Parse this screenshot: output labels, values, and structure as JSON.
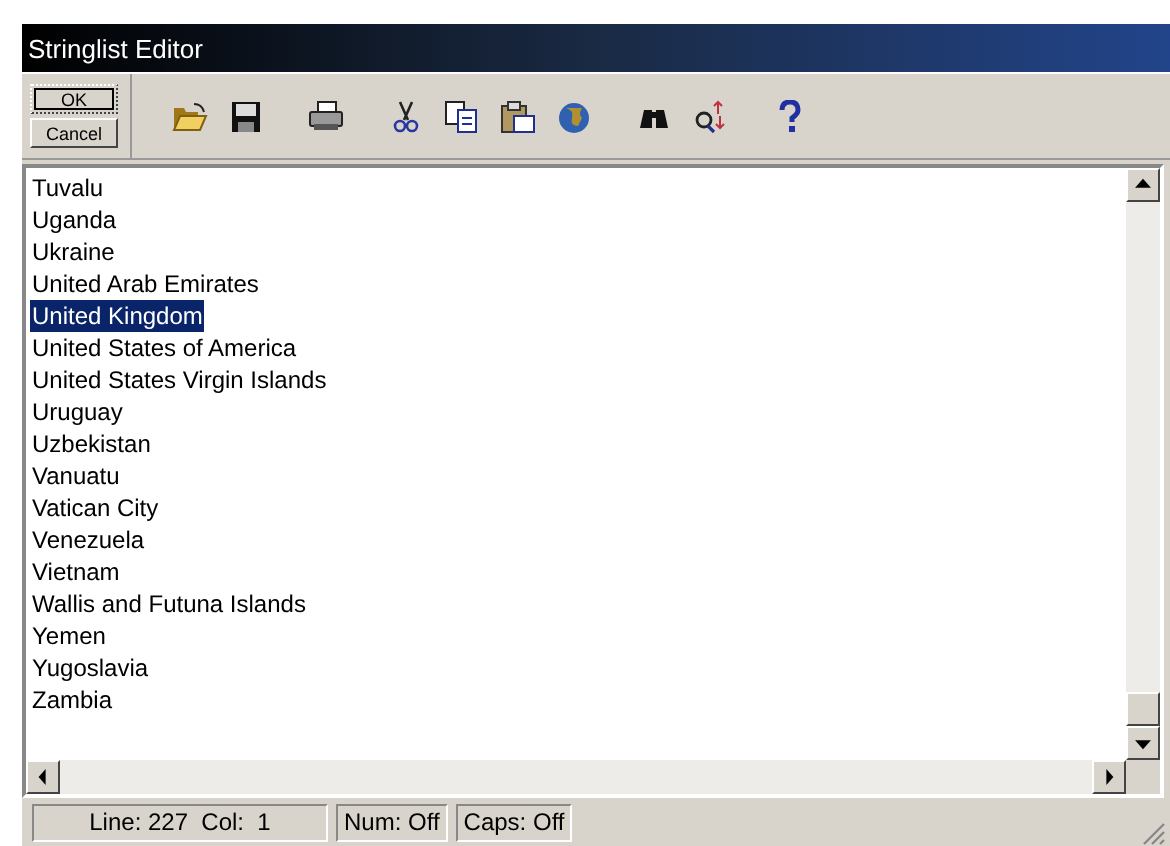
{
  "window": {
    "title": "Stringlist Editor"
  },
  "buttons": [
    {
      "label": "OK",
      "kind": "default"
    },
    {
      "label": "Cancel",
      "kind": "normal"
    }
  ],
  "toolbar": [
    {
      "kind": "open"
    },
    {
      "kind": "save"
    },
    {
      "kind": "sep"
    },
    {
      "kind": "print"
    },
    {
      "kind": "sep"
    },
    {
      "kind": "cut"
    },
    {
      "kind": "copy"
    },
    {
      "kind": "paste"
    },
    {
      "kind": "globe"
    },
    {
      "kind": "sep"
    },
    {
      "kind": "find"
    },
    {
      "kind": "replace"
    },
    {
      "kind": "sep"
    },
    {
      "kind": "help"
    }
  ],
  "lines": [
    {
      "text": "Tuvalu",
      "selected": false
    },
    {
      "text": "Uganda",
      "selected": false
    },
    {
      "text": "Ukraine",
      "selected": false
    },
    {
      "text": "United Arab Emirates",
      "selected": false
    },
    {
      "text": "United Kingdom",
      "selected": true
    },
    {
      "text": "United States of America",
      "selected": false
    },
    {
      "text": "United States Virgin Islands",
      "selected": false
    },
    {
      "text": "Uruguay",
      "selected": false
    },
    {
      "text": "Uzbekistan",
      "selected": false
    },
    {
      "text": "Vanuatu",
      "selected": false
    },
    {
      "text": "Vatican City",
      "selected": false
    },
    {
      "text": "Venezuela",
      "selected": false
    },
    {
      "text": "Vietnam",
      "selected": false
    },
    {
      "text": "Wallis and Futuna Islands",
      "selected": false
    },
    {
      "text": "Yemen",
      "selected": false
    },
    {
      "text": "Yugoslavia",
      "selected": false
    },
    {
      "text": "Zambia",
      "selected": false
    }
  ],
  "status_bar": [
    "Line: 227  Col:  1",
    "Num: Off",
    "Caps: Off"
  ]
}
